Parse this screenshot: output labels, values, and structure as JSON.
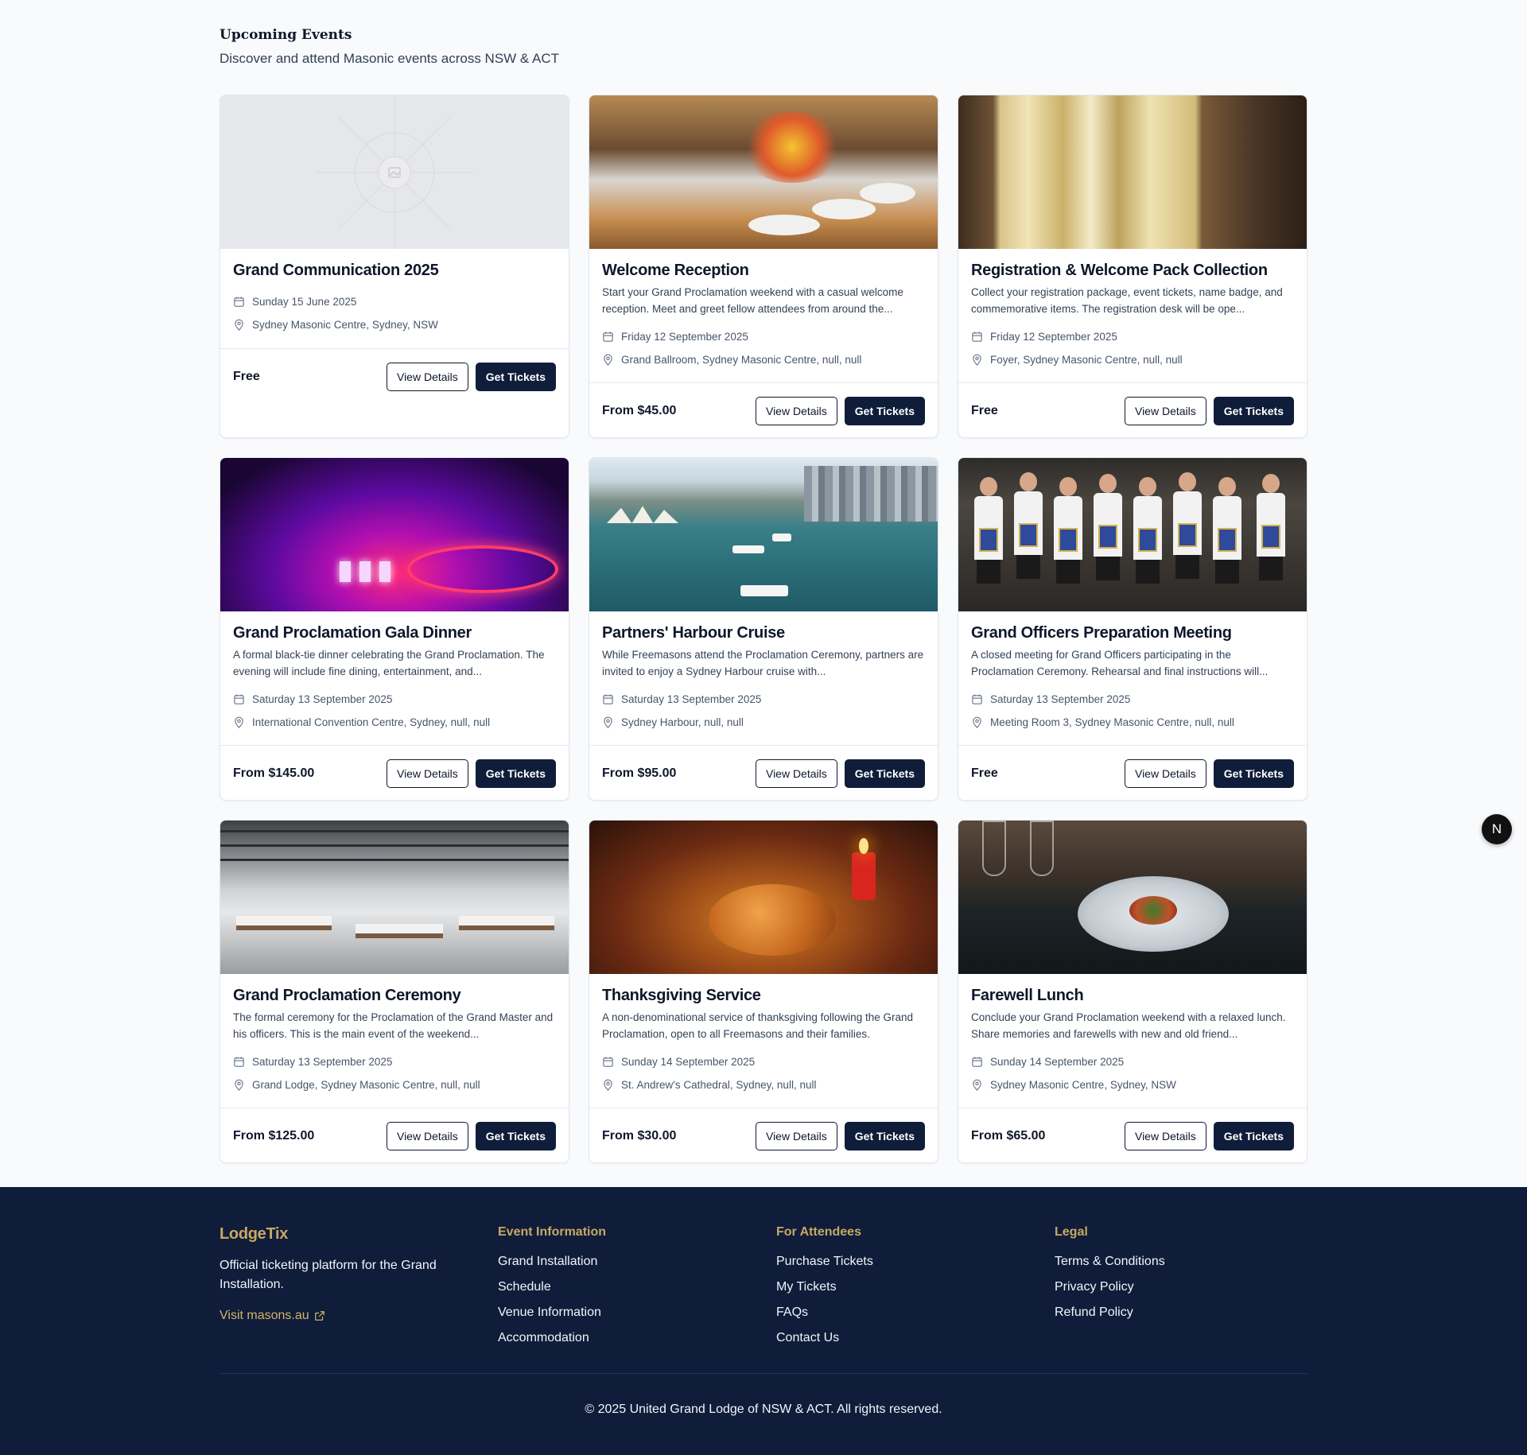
{
  "header": {
    "title": "Upcoming Events",
    "subtitle": "Discover and attend Masonic events across NSW & ACT"
  },
  "buttons": {
    "view_details": "View Details",
    "get_tickets": "Get Tickets"
  },
  "events": [
    {
      "title": "Grand Communication 2025",
      "description": "",
      "date": "Sunday 15 June 2025",
      "location": "Sydney Masonic Centre, Sydney, NSW",
      "price": "Free"
    },
    {
      "title": "Welcome Reception",
      "description": "Start your Grand Proclamation weekend with a casual welcome reception. Meet and greet fellow attendees from around the...",
      "date": "Friday 12 September 2025",
      "location": "Grand Ballroom, Sydney Masonic Centre, null, null",
      "price": "From $45.00"
    },
    {
      "title": "Registration & Welcome Pack Collection",
      "description": "Collect your registration package, event tickets, name badge, and commemorative items. The registration desk will be ope...",
      "date": "Friday 12 September 2025",
      "location": "Foyer, Sydney Masonic Centre, null, null",
      "price": "Free"
    },
    {
      "title": "Grand Proclamation Gala Dinner",
      "description": "A formal black-tie dinner celebrating the Grand Proclamation. The evening will include fine dining, entertainment, and...",
      "date": "Saturday 13 September 2025",
      "location": "International Convention Centre, Sydney, null, null",
      "price": "From $145.00"
    },
    {
      "title": "Partners' Harbour Cruise",
      "description": "While Freemasons attend the Proclamation Ceremony, partners are invited to enjoy a Sydney Harbour cruise with...",
      "date": "Saturday 13 September 2025",
      "location": "Sydney Harbour, null, null",
      "price": "From $95.00"
    },
    {
      "title": "Grand Officers Preparation Meeting",
      "description": "A closed meeting for Grand Officers participating in the Proclamation Ceremony. Rehearsal and final instructions will...",
      "date": "Saturday 13 September 2025",
      "location": "Meeting Room 3, Sydney Masonic Centre, null, null",
      "price": "Free"
    },
    {
      "title": "Grand Proclamation Ceremony",
      "description": "The formal ceremony for the Proclamation of the Grand Master and his officers. This is the main event of the weekend...",
      "date": "Saturday 13 September 2025",
      "location": "Grand Lodge, Sydney Masonic Centre, null, null",
      "price": "From $125.00"
    },
    {
      "title": "Thanksgiving Service",
      "description": "A non-denominational service of thanksgiving following the Grand Proclamation, open to all Freemasons and their families.",
      "date": "Sunday 14 September 2025",
      "location": "St. Andrew's Cathedral, Sydney, null, null",
      "price": "From $30.00"
    },
    {
      "title": "Farewell Lunch",
      "description": "Conclude your Grand Proclamation weekend with a relaxed lunch. Share memories and farewells with new and old friend...",
      "date": "Sunday 14 September 2025",
      "location": "Sydney Masonic Centre, Sydney, NSW",
      "price": "From $65.00"
    }
  ],
  "floating_badge": "N",
  "footer": {
    "brand": "LodgeTix",
    "description": "Official ticketing platform for the Grand Installation.",
    "visit_link": "Visit masons.au",
    "columns": [
      {
        "title": "Event Information",
        "links": [
          "Grand Installation",
          "Schedule",
          "Venue Information",
          "Accommodation"
        ]
      },
      {
        "title": "For Attendees",
        "links": [
          "Purchase Tickets",
          "My Tickets",
          "FAQs",
          "Contact Us"
        ]
      },
      {
        "title": "Legal",
        "links": [
          "Terms & Conditions",
          "Privacy Policy",
          "Refund Policy"
        ]
      }
    ],
    "copyright": "© 2025 United Grand Lodge of NSW & ACT. All rights reserved."
  },
  "colors": {
    "page_bg": "#f8fafc",
    "primary_navy": "#0f1d3a",
    "accent_gold": "#c8a864",
    "card_border": "#e2e8f0"
  },
  "icons": {
    "date": "calendar-icon",
    "location": "map-pin-icon",
    "external": "external-link-icon",
    "placeholder": "image-placeholder-icon"
  }
}
